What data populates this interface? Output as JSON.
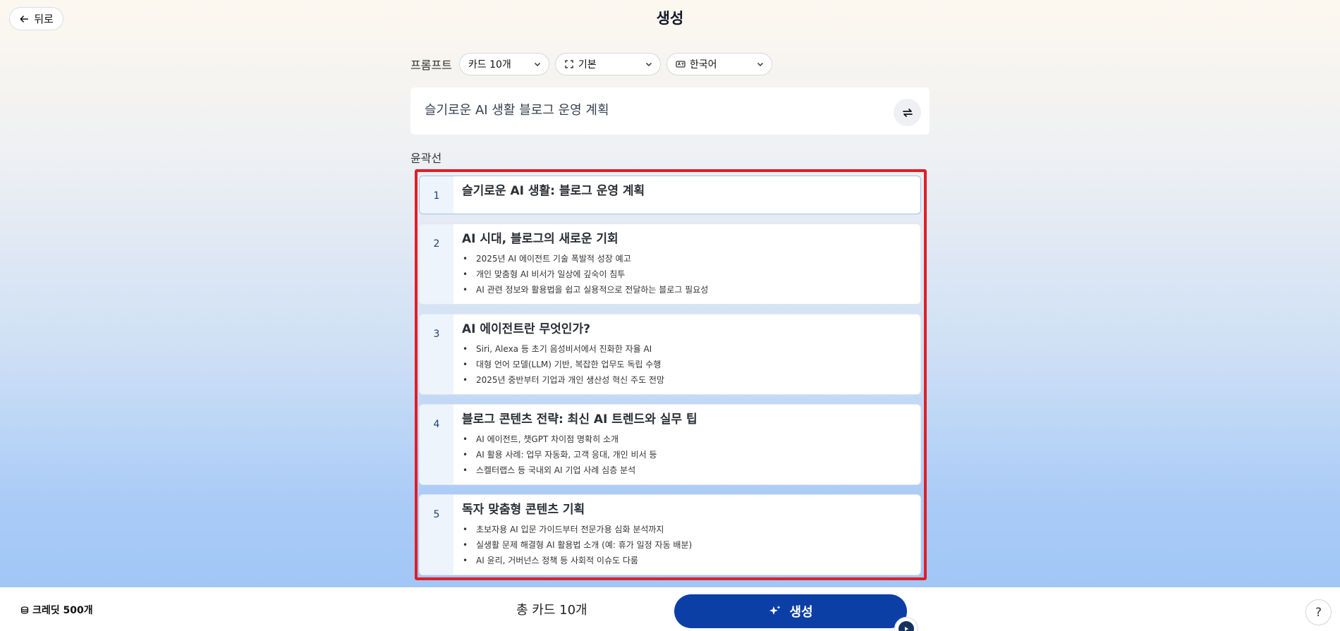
{
  "header": {
    "back_label": "뒤로",
    "title": "생성"
  },
  "prompt_bar": {
    "label": "프롬프트",
    "card_count": "카드 10개",
    "style": "기본",
    "language": "한국어"
  },
  "topic": {
    "text": "슬기로운 AI 생활 블로그 운영 계획"
  },
  "outline": {
    "label": "윤곽선",
    "cards": [
      {
        "num": "1",
        "title": "슬기로운 AI 생활: 블로그 운영 계획",
        "bullets": []
      },
      {
        "num": "2",
        "title": "AI 시대, 블로그의 새로운 기회",
        "bullets": [
          "2025년 AI 에이전트 기술 폭발적 성장 예고",
          "개인 맞춤형 AI 비서가 일상에 깊숙이 침투",
          "AI 관련 정보와 활용법을 쉽고 실용적으로 전달하는 블로그 필요성"
        ]
      },
      {
        "num": "3",
        "title": "AI 에이전트란 무엇인가?",
        "bullets": [
          "Siri, Alexa 등 초기 음성비서에서 진화한 자율 AI",
          "대형 언어 모델(LLM) 기반, 복잡한 업무도 독립 수행",
          "2025년 중반부터 기업과 개인 생산성 혁신 주도 전망"
        ]
      },
      {
        "num": "4",
        "title": "블로그 콘텐츠 전략: 최신 AI 트렌드와 실무 팁",
        "bullets": [
          "AI 에이전트, 챗GPT 차이점 명확히 소개",
          "AI 활용 사례: 업무 자동화, 고객 응대, 개인 비서 등",
          "스켈터랩스 등 국내외 AI 기업 사례 심층 분석"
        ]
      },
      {
        "num": "5",
        "title": "독자 맞춤형 콘텐츠 기획",
        "bullets": [
          "초보자용 AI 입문 가이드부터 전문가용 심화 분석까지",
          "실생활 문제 해결형 AI 활용법 소개 (예: 휴가 일정 자동 배분)",
          "AI 윤리, 거버넌스 정책 등 사회적 이슈도 다룸"
        ]
      }
    ]
  },
  "footer": {
    "credits": "크레딧 500개",
    "total_cards": "총 카드 10개",
    "generate_label": "생성",
    "help": "?"
  },
  "colors": {
    "primary": "#0b3fa6",
    "highlight_frame": "#e01e26",
    "card_number_bg": "#edf4fc"
  }
}
